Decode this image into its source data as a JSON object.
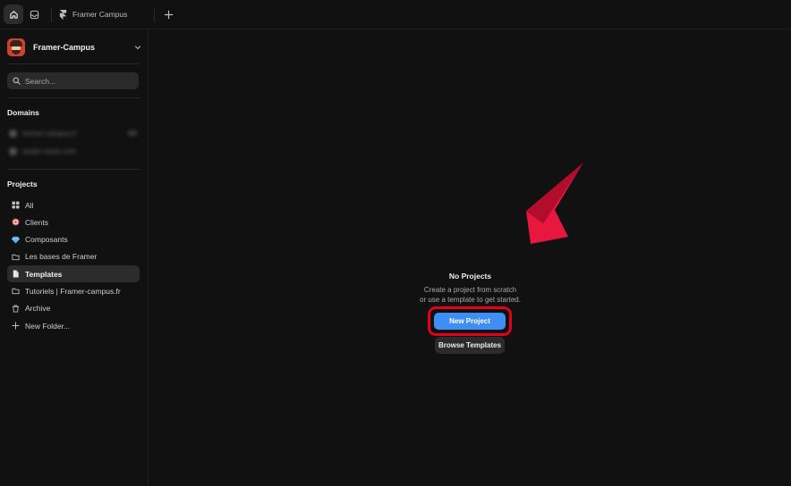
{
  "topbar": {
    "tab_label": "Framer Campus",
    "icons": [
      "home-icon",
      "inbox-icon",
      "framer-logo-icon",
      "plus-icon"
    ]
  },
  "sidebar": {
    "workspace_name": "Framer-Campus",
    "search_placeholder": "Search...",
    "domains_title": "Domains",
    "domains": [
      {
        "label": "framer-campus.fr"
      },
      {
        "label": "studio-news.com"
      }
    ],
    "projects_title": "Projects",
    "items": [
      {
        "label": "All",
        "icon": "grid-icon"
      },
      {
        "label": "Clients",
        "icon": "target-emoji-icon"
      },
      {
        "label": "Composants",
        "icon": "gem-emoji-icon"
      },
      {
        "label": "Les bases de Framer",
        "icon": "folder-icon"
      },
      {
        "label": "Templates",
        "icon": "file-icon",
        "active": true
      },
      {
        "label": "Tutoriels | Framer-campus.fr",
        "icon": "folder-icon"
      },
      {
        "label": "Archive",
        "icon": "trash-icon"
      },
      {
        "label": "New Folder...",
        "icon": "plus-icon"
      }
    ]
  },
  "main": {
    "empty_title": "No Projects",
    "empty_desc_line1": "Create a project from scratch",
    "empty_desc_line2": "or use a template to get started.",
    "new_project_label": "New Project",
    "browse_templates_label": "Browse Templates"
  },
  "colors": {
    "background": "#111111",
    "accent": "#3f8ef5",
    "highlight": "#e3001b",
    "arrow": "#e8173f"
  }
}
